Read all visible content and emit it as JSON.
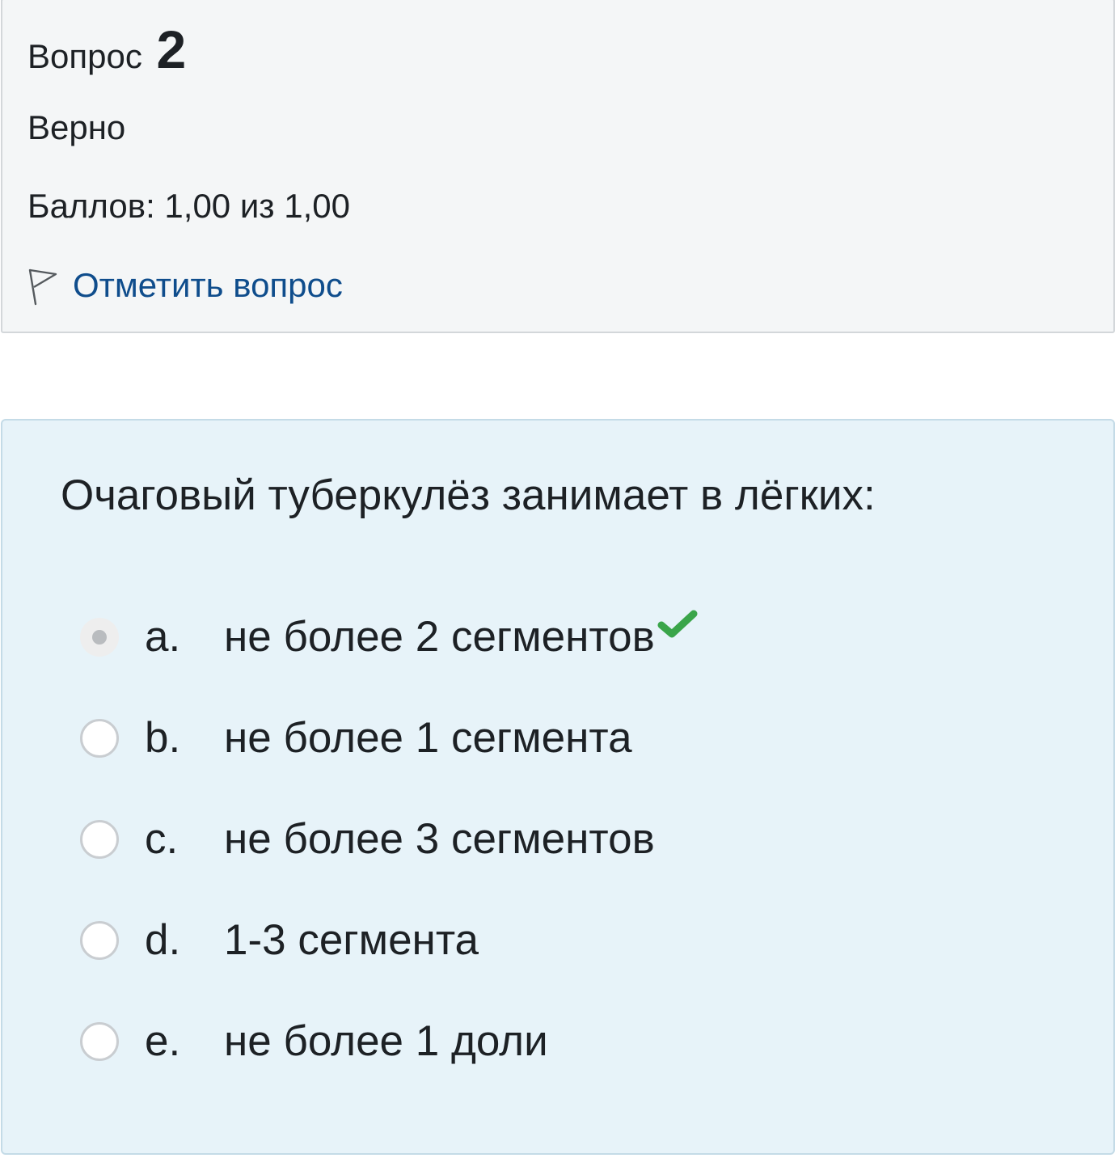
{
  "info": {
    "question_label": "Вопрос",
    "question_number": "2",
    "state": "Верно",
    "grade": "Баллов: 1,00 из 1,00",
    "flag_label": "Отметить вопрос",
    "flag_icon": "flag-outline-icon"
  },
  "question": {
    "text": "Очаговый туберкулёз занимает в лёгких:",
    "answers": [
      {
        "letter": "a.",
        "text": "не более 2 сегментов",
        "selected": true,
        "correct": true
      },
      {
        "letter": "b.",
        "text": "не более 1 сегмента",
        "selected": false,
        "correct": false
      },
      {
        "letter": "c.",
        "text": "не более 3 сегментов",
        "selected": false,
        "correct": false
      },
      {
        "letter": "d.",
        "text": "1-3 сегмента",
        "selected": false,
        "correct": false
      },
      {
        "letter": "e.",
        "text": "не более 1 доли",
        "selected": false,
        "correct": false
      }
    ],
    "correct_icon": "checkmark-icon"
  },
  "colors": {
    "info_background": "#f4f6f7",
    "question_background": "#e7f3f9",
    "link": "#0f4d8c",
    "check": "#3aa54a",
    "text": "#1d2125"
  }
}
